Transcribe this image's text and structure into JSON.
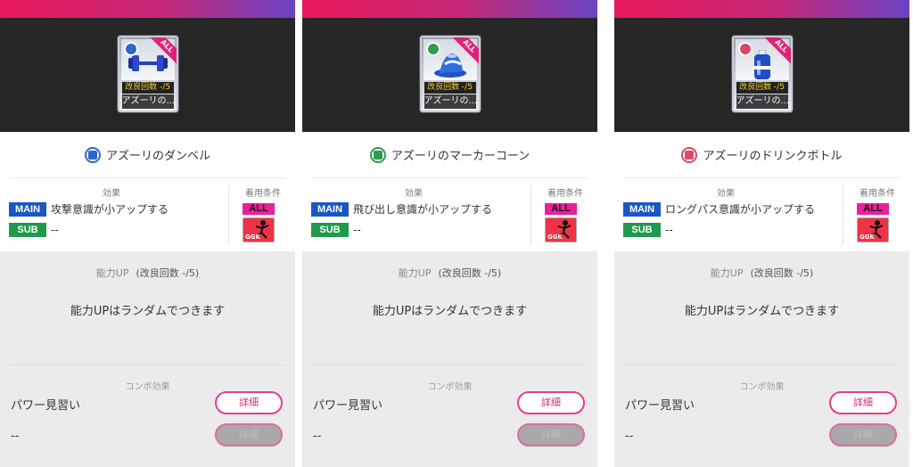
{
  "panels": [
    {
      "card_count": "改良回数 -/5",
      "card_name": "アズーリの...",
      "card_all": "ALL",
      "item_name": "アズーリのダンベル",
      "type_color": "#2f66c9",
      "type_icon": "shirt-icon",
      "effect_label": "効果",
      "condition_label": "着用条件",
      "main_tag": "MAIN",
      "main_text": "攻撃意識が小アップする",
      "sub_tag": "SUB",
      "sub_text": "--",
      "cond_all": "ALL",
      "cond_pos": "GGK",
      "ability_label": "能力UP",
      "ability_sub": "(改良回数 -/5)",
      "ability_msg": "能力UPはランダムでつきます",
      "combo_label": "コンボ効果",
      "combo1_name": "パワー見習い",
      "combo1_button": "詳細",
      "combo2_name": "--",
      "combo2_button": "詳細"
    },
    {
      "card_count": "改良回数 -/5",
      "card_name": "アズーリの...",
      "card_all": "ALL",
      "item_name": "アズーリのマーカーコーン",
      "type_color": "#2e9d4d",
      "type_icon": "pants-icon",
      "effect_label": "効果",
      "condition_label": "着用条件",
      "main_tag": "MAIN",
      "main_text": "飛び出し意識が小アップする",
      "sub_tag": "SUB",
      "sub_text": "--",
      "cond_all": "ALL",
      "cond_pos": "GGK",
      "ability_label": "能力UP",
      "ability_sub": "(改良回数 -/5)",
      "ability_msg": "能力UPはランダムでつきます",
      "combo_label": "コンボ効果",
      "combo1_name": "パワー見習い",
      "combo1_button": "詳細",
      "combo2_name": "--",
      "combo2_button": "詳細"
    },
    {
      "card_count": "改良回数 -/5",
      "card_name": "アズーリの...",
      "card_all": "ALL",
      "item_name": "アズーリのドリンクボトル",
      "type_color": "#d94a6a",
      "type_icon": "socks-icon",
      "effect_label": "効果",
      "condition_label": "着用条件",
      "main_tag": "MAIN",
      "main_text": "ロングパス意識が小アップする",
      "sub_tag": "SUB",
      "sub_text": "--",
      "cond_all": "ALL",
      "cond_pos": "GGK",
      "ability_label": "能力UP",
      "ability_sub": "(改良回数 -/5)",
      "ability_msg": "能力UPはランダムでつきます",
      "combo_label": "コンボ効果",
      "combo1_name": "パワー見習い",
      "combo1_button": "詳細",
      "combo2_name": "--",
      "combo2_button": "詳細"
    }
  ]
}
